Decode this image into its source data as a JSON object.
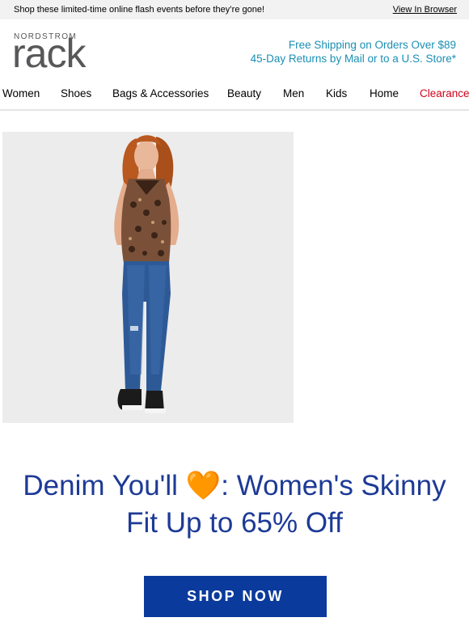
{
  "topbar": {
    "promo_text": "Shop these limited-time online flash events before they’re gone!",
    "view_in_browser": "View In Browser"
  },
  "brand": {
    "logo_top": "NORDSTROM",
    "logo_main": "rack"
  },
  "shipping": {
    "line1": "Free Shipping on Orders Over $89",
    "line2": "45-Day Returns by Mail or to a U.S. Store*"
  },
  "nav": {
    "items": [
      {
        "label": "Women"
      },
      {
        "label": "Shoes"
      },
      {
        "label": "Bags & Accessories"
      },
      {
        "label": "Beauty"
      },
      {
        "label": "Men"
      },
      {
        "label": "Kids"
      },
      {
        "label": "Home"
      },
      {
        "label": "Clearance"
      }
    ]
  },
  "hero": {
    "headline_line1_prefix": "Denim You'll",
    "headline_emoji": "🧡",
    "headline_line1_suffix": ": Women's Skinny",
    "headline_line2": "Fit Up to 65% Off",
    "cta_label": "SHOP NOW"
  },
  "colors": {
    "accent_blue": "#0a3a9c",
    "headline_blue": "#1d3a96",
    "shipping_teal": "#1a8fb5",
    "clearance_red": "#d0021b"
  }
}
